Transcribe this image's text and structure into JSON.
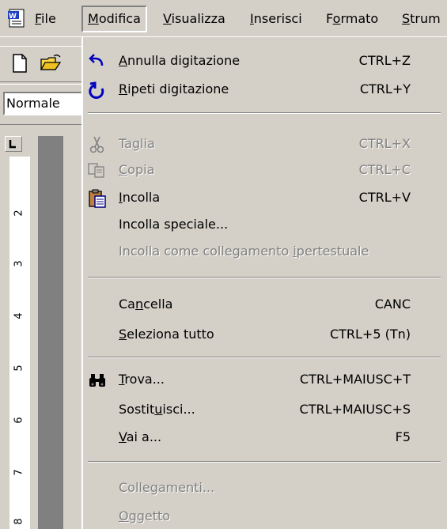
{
  "menubar": {
    "items": [
      {
        "pre": "",
        "key": "F",
        "post": "ile"
      },
      {
        "pre": "",
        "key": "M",
        "post": "odifica"
      },
      {
        "pre": "",
        "key": "V",
        "post": "isualizza"
      },
      {
        "pre": "",
        "key": "I",
        "post": "nserisci"
      },
      {
        "pre": "F",
        "key": "o",
        "post": "rmato"
      },
      {
        "pre": "",
        "key": "S",
        "post": "trum"
      }
    ]
  },
  "toolbar": {
    "style_value": "Normale",
    "ruler_top_number": "2"
  },
  "ruler": {
    "numbers": [
      "2",
      "3",
      "4",
      "5",
      "6",
      "7",
      "8"
    ]
  },
  "dropdown": {
    "items": [
      {
        "pre": "",
        "key": "A",
        "post": "nnulla digitazione",
        "shortcut": "CTRL+Z",
        "icon": "undo-icon",
        "disabled": false
      },
      {
        "pre": "",
        "key": "R",
        "post": "ipeti digitazione",
        "shortcut": "CTRL+Y",
        "icon": "redo-icon",
        "disabled": false
      },
      {
        "pre": "Ta",
        "key": "g",
        "post": "lia",
        "shortcut": "CTRL+X",
        "icon": "scissors-icon",
        "disabled": true
      },
      {
        "pre": "",
        "key": "C",
        "post": "opia",
        "shortcut": "CTRL+C",
        "icon": "copy-icon",
        "disabled": true
      },
      {
        "pre": "",
        "key": "I",
        "post": "ncolla",
        "shortcut": "CTRL+V",
        "icon": "paste-icon",
        "disabled": false
      },
      {
        "pre": "Incolla speciale...",
        "key": "",
        "post": "",
        "shortcut": "",
        "icon": "",
        "disabled": false
      },
      {
        "pre": "Incolla come collegamento ",
        "key": "i",
        "post": "pertestuale",
        "shortcut": "",
        "icon": "",
        "disabled": true
      },
      {
        "pre": "Ca",
        "key": "n",
        "post": "cella",
        "shortcut": "CANC",
        "icon": "",
        "disabled": false
      },
      {
        "pre": "",
        "key": "S",
        "post": "eleziona tutto",
        "shortcut": "CTRL+5 (Tn)",
        "icon": "",
        "disabled": false
      },
      {
        "pre": "",
        "key": "T",
        "post": "rova...",
        "shortcut": "CTRL+MAIUSC+T",
        "icon": "binoculars-icon",
        "disabled": false
      },
      {
        "pre": "Sostit",
        "key": "u",
        "post": "isci...",
        "shortcut": "CTRL+MAIUSC+S",
        "icon": "",
        "disabled": false
      },
      {
        "pre": "",
        "key": "V",
        "post": "ai a...",
        "shortcut": "F5",
        "icon": "",
        "disabled": false
      },
      {
        "pre": "Collegamenti...",
        "key": "",
        "post": "",
        "shortcut": "",
        "icon": "",
        "disabled": true
      },
      {
        "pre": "",
        "key": "O",
        "post": "ggetto",
        "shortcut": "",
        "icon": "",
        "disabled": true
      }
    ]
  }
}
